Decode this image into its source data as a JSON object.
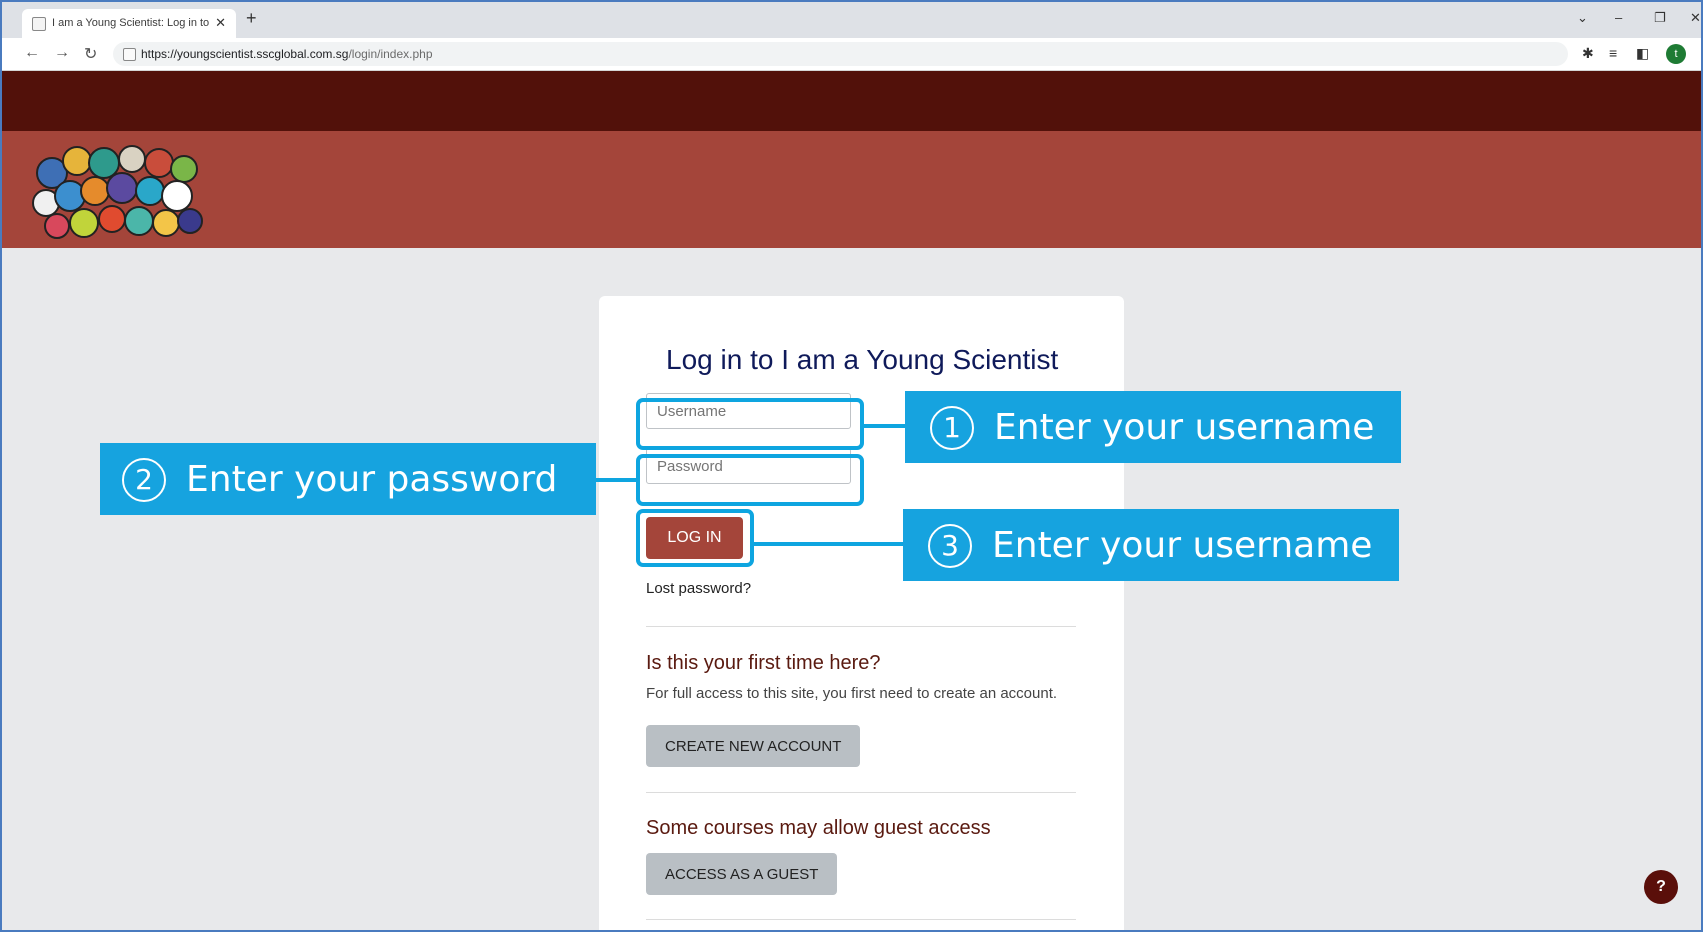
{
  "browser": {
    "tab_title": "I am a Young Scientist: Log in to",
    "tab_close": "✕",
    "new_tab": "+",
    "url_host": "https://youngscientist.sscglobal.com.sg",
    "url_path": "/login/index.php",
    "profile_initial": "t",
    "window_controls": [
      "⌄",
      "–",
      "❐",
      "✕"
    ]
  },
  "login": {
    "heading": "Log in to I am a Young Scientist",
    "username_placeholder": "Username",
    "password_placeholder": "Password",
    "login_button": "LOG IN",
    "lost_password": "Lost password?",
    "first_time_title": "Is this your first time here?",
    "first_time_desc": "For full access to this site, you first need to create an account.",
    "create_account_button": "CREATE NEW ACCOUNT",
    "guest_title": "Some courses may allow guest access",
    "guest_button": "ACCESS AS A GUEST"
  },
  "callouts": {
    "step1_num": "1",
    "step1_text": "Enter your username",
    "step2_num": "2",
    "step2_text": "Enter your password",
    "step3_num": "3",
    "step3_text": "Enter your username"
  },
  "help": {
    "label": "?"
  },
  "colors": {
    "top_nav": "#52110a",
    "banner": "#a4453a",
    "accent_button": "#a4453a",
    "callout": "#16a3df",
    "heading": "#0f1a5a"
  },
  "icons": {
    "back": "arrow-left-icon",
    "forward": "arrow-right-icon",
    "reload": "reload-icon",
    "extensions": "puzzle-icon",
    "reading_list": "reading-list-icon",
    "side_panel": "side-panel-icon",
    "help": "help-icon"
  }
}
